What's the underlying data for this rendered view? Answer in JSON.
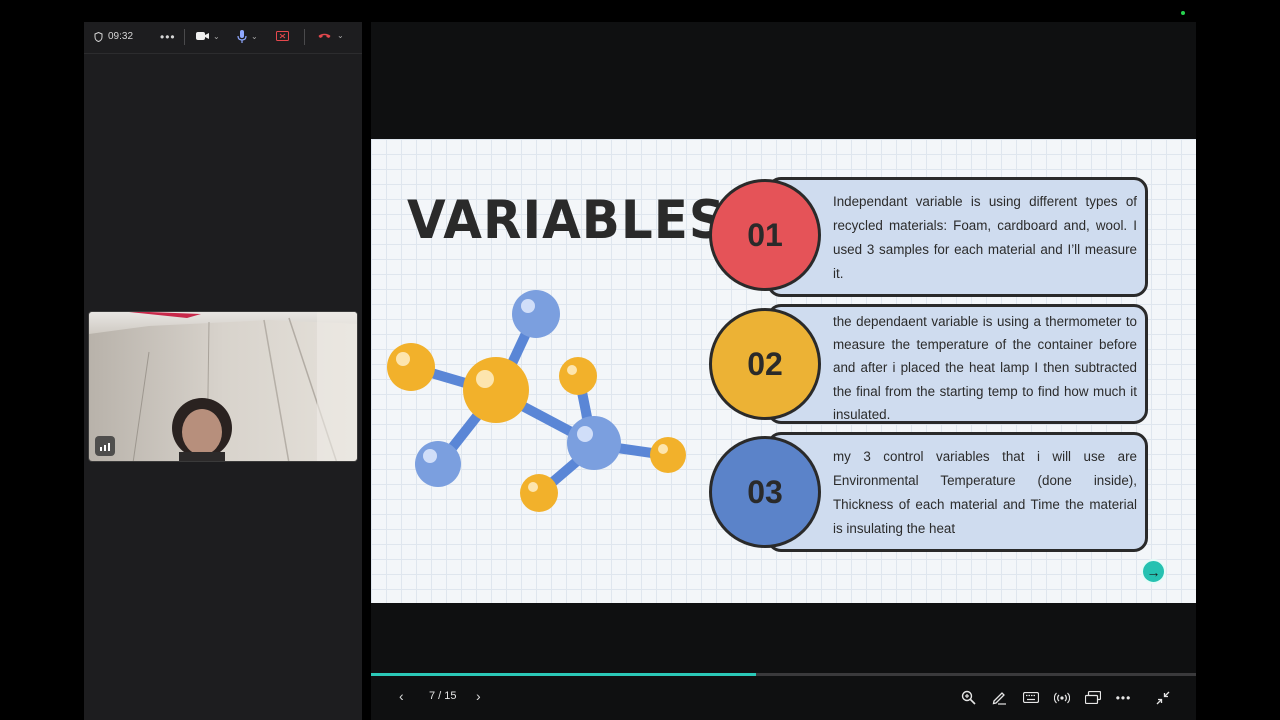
{
  "call": {
    "timer": "09:32",
    "icons": [
      "shield-icon",
      "more-icon",
      "camera-icon",
      "microphone-icon",
      "screen-share-icon",
      "hang-up-icon",
      "network-stats-icon"
    ]
  },
  "slide": {
    "title": "VARIABLES",
    "items": [
      {
        "number": "01",
        "color": "#e55358",
        "text": "Independant variable is using different types of recycled materials: Foam, cardboard and, wool. I used 3 samples for each material and I’ll measure it."
      },
      {
        "number": "02",
        "color": "#ecb235",
        "text": "the dependaent variable is using a thermometer to measure the temperature of the container before and after i placed the heat lamp I then subtracted the final from the starting temp to find how much it insulated."
      },
      {
        "number": "03",
        "color": "#5b83c9",
        "text": "my 3 control variables that i will use are Environmental Temperature (done inside), Thickness of each material and Time the material is insulating the heat"
      }
    ]
  },
  "presentation": {
    "current_page": 7,
    "total_pages": 15,
    "page_label": "7 / 15",
    "progress": 0.467,
    "accent": "#2bc9b8",
    "toolbar_icons": [
      "zoom-icon",
      "pen-icon",
      "keyboard-icon",
      "broadcast-icon",
      "present-icon",
      "more-icon",
      "exit-fullscreen-icon"
    ]
  }
}
